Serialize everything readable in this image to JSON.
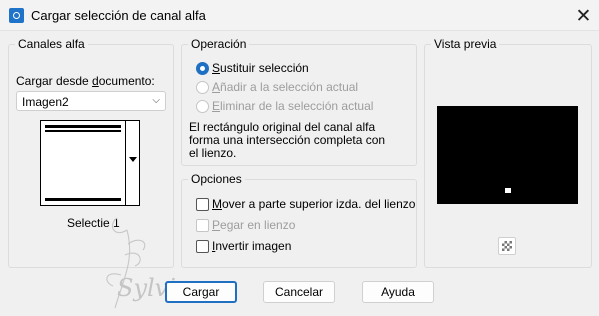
{
  "window": {
    "title": "Cargar selección de canal alfa",
    "close_glyph": "✕"
  },
  "canales": {
    "title": "Canales alfa",
    "load_label_pre": "Cargar desde ",
    "load_label_u": "d",
    "load_label_post": "ocumento:",
    "document_value": "Imagen2",
    "channel_name": "Selectie 1"
  },
  "operacion": {
    "title": "Operación",
    "options": [
      {
        "u": "S",
        "rest": "ustituir selección",
        "selected": true,
        "enabled": true
      },
      {
        "u": "A",
        "rest": "ñadir a la selección actual",
        "selected": false,
        "enabled": false
      },
      {
        "u": "E",
        "rest": "liminar de la selección actual",
        "selected": false,
        "enabled": false
      }
    ],
    "note_line1": "El rectángulo original del canal alfa",
    "note_line2": "forma una intersección completa con",
    "note_line3": "el lienzo."
  },
  "opciones": {
    "title": "Opciones",
    "move": {
      "u": "M",
      "rest": "over a parte superior izda. del lienzo",
      "checked": false,
      "enabled": true
    },
    "paste": {
      "u": "P",
      "rest": "egar en lienzo",
      "checked": false,
      "enabled": false
    },
    "invert": {
      "u": "I",
      "rest": "nvertir imagen",
      "checked": false,
      "enabled": true
    }
  },
  "vista": {
    "title": "Vista previa",
    "icon": "transparency-checker-icon"
  },
  "buttons": {
    "load": "Cargar",
    "cancel": "Cancelar",
    "help": "Ayuda"
  },
  "watermark": {
    "text": "Sylviane"
  },
  "colors": {
    "accent": "#1f6fc2",
    "preview_bg": "#000000"
  }
}
